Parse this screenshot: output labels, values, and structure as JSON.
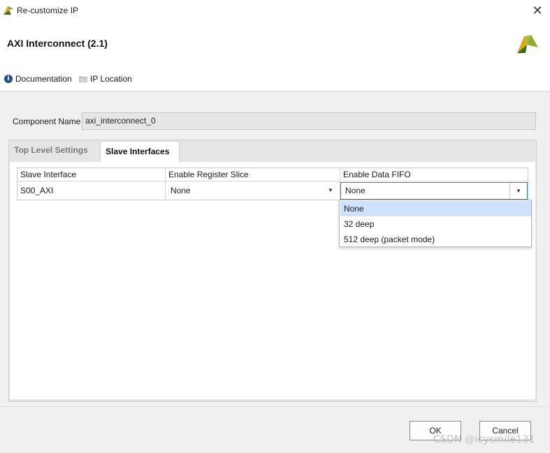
{
  "window": {
    "title": "Re-customize IP",
    "close_label": "✕"
  },
  "header": {
    "ip_title": "AXI Interconnect (2.1)"
  },
  "links": {
    "documentation": "Documentation",
    "ip_location": "IP Location"
  },
  "component": {
    "label": "Component Name",
    "value": "axi_interconnect_0"
  },
  "tabs": [
    {
      "label": "Top Level Settings",
      "active": false
    },
    {
      "label": "Slave Interfaces",
      "active": true
    }
  ],
  "table": {
    "headers": [
      "Slave Interface",
      "Enable Register Slice",
      "Enable Data FIFO"
    ],
    "rows": [
      {
        "slave_interface": "S00_AXI",
        "register_slice": "None",
        "data_fifo": "None"
      }
    ]
  },
  "dropdown": {
    "options": [
      "None",
      "32 deep",
      "512 deep (packet mode)"
    ],
    "selected": "None"
  },
  "buttons": {
    "ok": "OK",
    "cancel": "Cancel"
  },
  "watermark": "CSDN @icysmile131",
  "colors": {
    "accent_blue": "#2f7fd8",
    "selected_option": "#cfe2fb",
    "logo_green": "#8faa2a"
  }
}
